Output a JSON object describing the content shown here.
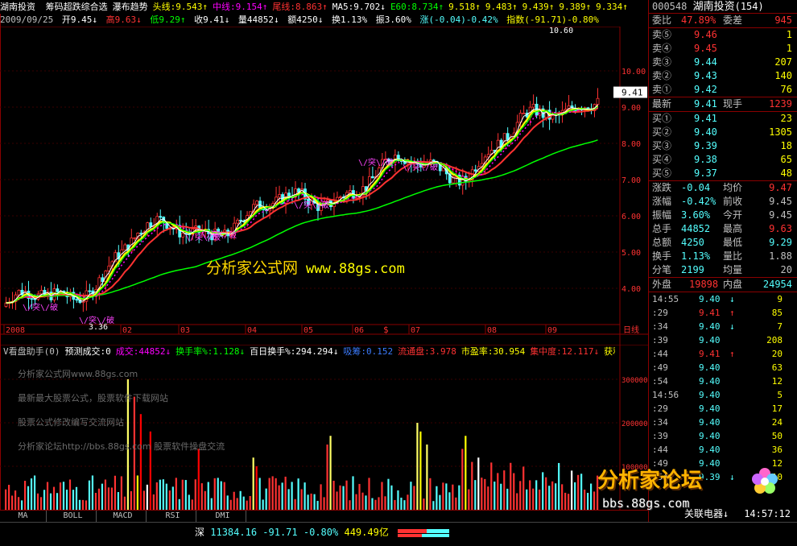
{
  "colors": {
    "up": "#ff3232",
    "down": "#54ffff",
    "yellow": "#ffff00",
    "green": "#00ff00",
    "white": "#ffffff",
    "magenta": "#ff00ff",
    "grid": "#8a0000"
  },
  "title": {
    "stock": "湖南投资",
    "items": [
      {
        "text": "筹码超跌综合选",
        "color": "#ffffff"
      },
      {
        "text": "瀑布趋势",
        "color": "#ffffff"
      },
      {
        "text": "头线:9.543↑",
        "color": "#ffff00"
      },
      {
        "text": "中线:9.154↑",
        "color": "#ff00ff"
      },
      {
        "text": "尾线:8.863↑",
        "color": "#ff3232"
      },
      {
        "text": "MA5:9.702↓",
        "color": "#ffffff"
      },
      {
        "text": "E60:8.734↑",
        "color": "#00ff00"
      },
      {
        "text": "9.518↑",
        "color": "#ffff00"
      },
      {
        "text": "9.483↑",
        "color": "#ffff00"
      },
      {
        "text": "9.439↑",
        "color": "#ffff00"
      },
      {
        "text": "9.389↑",
        "color": "#ffff00"
      },
      {
        "text": "9.334↑",
        "color": "#ffff00"
      }
    ]
  },
  "info": {
    "date": "2009/09/25",
    "open": "开9.45↓",
    "high": "高9.63↓",
    "low": "低9.29↑",
    "close": "收9.41↓",
    "vol": "量44852↓",
    "amount": "额4250↓",
    "turnover": "换1.13%",
    "amplitude": "振3.60%",
    "change": "涨(-0.04)-0.42%",
    "index": "指数(-91.71)-0.80%"
  },
  "main_price_labels": {
    "hi": "10.60",
    "lo": "3.36",
    "current": "9.41"
  },
  "axis": {
    "price_ticks": [
      "10.00",
      "9.00",
      "8.00",
      "7.00",
      "6.00",
      "5.00",
      "4.00"
    ],
    "months": [
      "2008",
      "02",
      "03",
      "04",
      "05",
      "06",
      "07",
      "08",
      "09"
    ],
    "right_label": "日线",
    "vol_ticks": [
      "300000",
      "200000",
      "100000"
    ]
  },
  "signals": [
    "\\/突\\/破",
    "\\/突\\/破",
    "\\/突\\/破",
    "\\/突\\/破",
    "\\/突\\/破",
    "\\/突\\/破",
    "\\/突\\/破"
  ],
  "watermark": {
    "cn": "分析家公式网",
    "url": "www.88gs.com"
  },
  "vol_header": {
    "items": [
      {
        "text": "V看盘助手(0)",
        "color": "#c0c0c0"
      },
      {
        "text": "预测成交:0",
        "color": "#ffffff"
      },
      {
        "text": "成交:44852↓",
        "color": "#ff00ff"
      },
      {
        "text": "换手率%:1.128↓",
        "color": "#00ff00"
      },
      {
        "text": "百日换手%:294.294↓",
        "color": "#ffffff"
      },
      {
        "text": "吸筹:0.152",
        "color": "#3c7cff"
      },
      {
        "text": "流通盘:3.978",
        "color": "#ff3232"
      },
      {
        "text": "市盈率:30.954",
        "color": "#ffff00"
      },
      {
        "text": "集中度:12.117↓",
        "color": "#ff3232"
      },
      {
        "text": "获利",
        "color": "#ffff00"
      }
    ]
  },
  "vol_watermarks": [
    "分析家公式网www.88gs.com",
    "最新最大股票公式，股票软件下载网站",
    "股票公式修改编写交流网站",
    "分析家论坛http://bbs.88gs.com 股票软件操盘交流"
  ],
  "tabs": [
    "MA",
    "BOLL",
    "MACD",
    "RSI",
    "DMI"
  ],
  "status": {
    "market": "深",
    "value": "11384.16",
    "change": "-91.71",
    "pct": "-0.80%",
    "amount": "449.49亿"
  },
  "panel": {
    "code": "000548",
    "name": "湖南投资",
    "num": "(154)",
    "weibi_label": "委比",
    "weibi": "47.89%",
    "weicha_label": "委差",
    "weicha": "945",
    "sells": [
      {
        "label": "卖⑤",
        "price": "9.46",
        "vol": "1"
      },
      {
        "label": "卖④",
        "price": "9.45",
        "vol": "1"
      },
      {
        "label": "卖③",
        "price": "9.44",
        "vol": "207"
      },
      {
        "label": "卖②",
        "price": "9.43",
        "vol": "140"
      },
      {
        "label": "卖①",
        "price": "9.42",
        "vol": "76"
      }
    ],
    "latest_label": "最新",
    "latest": "9.41",
    "xianshou_label": "现手",
    "xianshou": "1239",
    "buys": [
      {
        "label": "买①",
        "price": "9.41",
        "vol": "23"
      },
      {
        "label": "买②",
        "price": "9.40",
        "vol": "1305"
      },
      {
        "label": "买③",
        "price": "9.39",
        "vol": "18"
      },
      {
        "label": "买④",
        "price": "9.38",
        "vol": "65"
      },
      {
        "label": "买⑤",
        "price": "9.37",
        "vol": "48"
      }
    ],
    "stats": [
      {
        "l1": "涨跌",
        "v1": "-0.04",
        "l2": "均价",
        "v2": "9.47",
        "c2": "#ff3232"
      },
      {
        "l1": "涨幅",
        "v1": "-0.42%",
        "l2": "前收",
        "v2": "9.45",
        "c2": "#c0c0c0"
      },
      {
        "l1": "振幅",
        "v1": "3.60%",
        "l2": "今开",
        "v2": "9.45",
        "c2": "#c0c0c0"
      },
      {
        "l1": "总手",
        "v1": "44852",
        "l2": "最高",
        "v2": "9.63",
        "c2": "#ff3232"
      },
      {
        "l1": "总额",
        "v1": "4250",
        "l2": "最低",
        "v2": "9.29",
        "c2": "#54ffff"
      },
      {
        "l1": "换手",
        "v1": "1.13%",
        "l2": "量比",
        "v2": "1.88",
        "c2": "#c0c0c0"
      },
      {
        "l1": "分笔",
        "v1": "2199",
        "l2": "均量",
        "v2": "20",
        "c2": "#c0c0c0"
      }
    ],
    "waipan_label": "外盘",
    "waipan": "19898",
    "neipan_label": "内盘",
    "neipan": "24954",
    "ticks": [
      {
        "t": "14:55",
        "p": "9.40",
        "d": "↓",
        "v": "9",
        "c": "#54ffff"
      },
      {
        "t": ":29",
        "p": "9.41",
        "d": "↑",
        "v": "85",
        "c": "#ff3232"
      },
      {
        "t": ":34",
        "p": "9.40",
        "d": "↓",
        "v": "7",
        "c": "#54ffff"
      },
      {
        "t": ":39",
        "p": "9.40",
        "d": "",
        "v": "208",
        "c": "#54ffff"
      },
      {
        "t": ":44",
        "p": "9.41",
        "d": "↑",
        "v": "20",
        "c": "#ff3232"
      },
      {
        "t": ":49",
        "p": "9.40",
        "d": "",
        "v": "63",
        "c": "#54ffff"
      },
      {
        "t": ":54",
        "p": "9.40",
        "d": "",
        "v": "12",
        "c": "#54ffff"
      },
      {
        "t": "14:56",
        "p": "9.40",
        "d": "",
        "v": "5",
        "c": "#54ffff"
      },
      {
        "t": ":29",
        "p": "9.40",
        "d": "",
        "v": "17",
        "c": "#54ffff"
      },
      {
        "t": ":34",
        "p": "9.40",
        "d": "",
        "v": "24",
        "c": "#54ffff"
      },
      {
        "t": ":39",
        "p": "9.40",
        "d": "",
        "v": "50",
        "c": "#54ffff"
      },
      {
        "t": ":44",
        "p": "9.40",
        "d": "",
        "v": "36",
        "c": "#54ffff"
      },
      {
        "t": ":49",
        "p": "9.40",
        "d": "",
        "v": "12",
        "c": "#54ffff"
      },
      {
        "t": ":54",
        "p": "9.39",
        "d": "↓",
        "v": "10",
        "c": "#54ffff"
      }
    ],
    "footer": "关联电器↓",
    "footer_time": "14:57:12"
  },
  "logo": {
    "cn": "分析家论坛",
    "url": "bbs.88gs.com"
  },
  "chart_data": {
    "type": "candlestick",
    "price_range": [
      3.0,
      11.0
    ],
    "markers": {
      "high": 10.6,
      "low": 3.36,
      "last": 9.41
    },
    "monthly_closes": [
      {
        "month": "2008-12",
        "close": 3.6
      },
      {
        "month": "2009-01",
        "close": 3.7
      },
      {
        "month": "2009-02",
        "close": 5.5
      },
      {
        "month": "2009-03",
        "close": 5.6
      },
      {
        "month": "2009-04",
        "close": 6.2
      },
      {
        "month": "2009-05",
        "close": 6.6
      },
      {
        "month": "2009-06",
        "close": 7.4
      },
      {
        "month": "2009-07",
        "close": 7.3
      },
      {
        "month": "2009-08",
        "close": 8.6
      },
      {
        "month": "2009-09",
        "close": 9.41
      }
    ],
    "volume_range": [
      0,
      350000
    ]
  }
}
